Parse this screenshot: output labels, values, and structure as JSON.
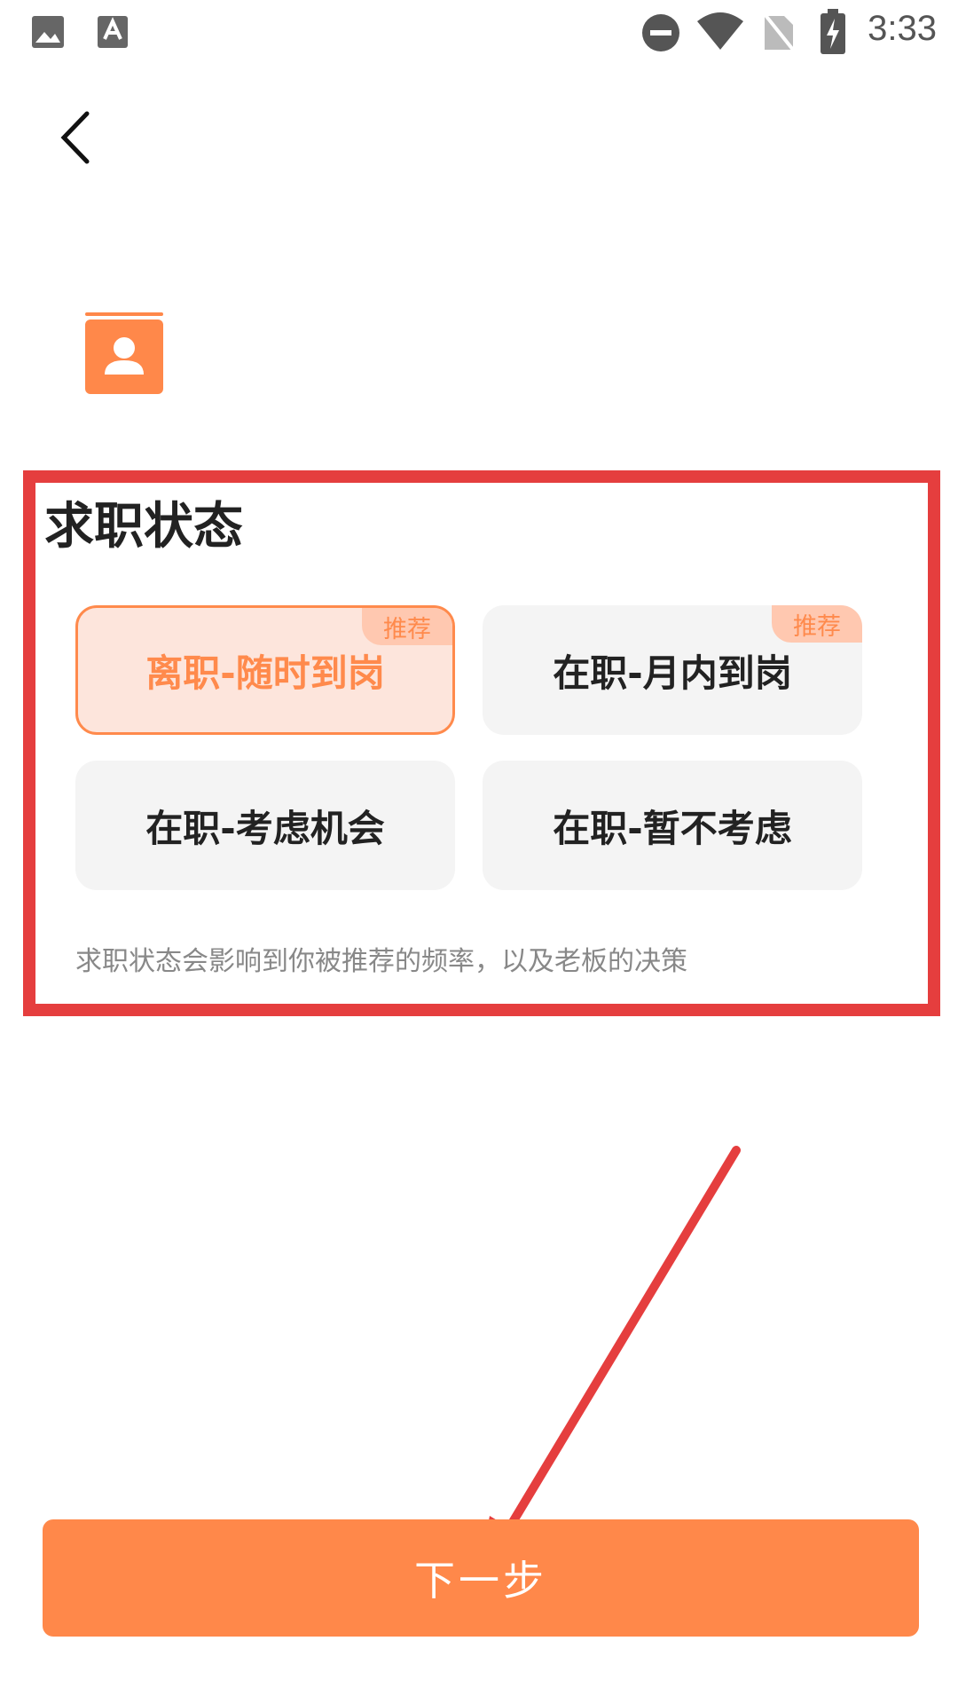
{
  "status_bar": {
    "time": "3:33",
    "left_icons": [
      "image-icon",
      "font-download-icon"
    ],
    "right_icons": [
      "do-not-disturb-icon",
      "wifi-icon",
      "no-sim-icon",
      "battery-charging-icon"
    ]
  },
  "header": {
    "back_icon": "chevron-left-icon"
  },
  "section": {
    "title": "求职状态",
    "hint": "求职状态会影响到你被推荐的频率，以及老板的决策"
  },
  "options": [
    {
      "label": "离职-随时到岗",
      "tag": "推荐",
      "selected": true
    },
    {
      "label": "在职-月内到岗",
      "tag": "推荐",
      "selected": false
    },
    {
      "label": "在职-考虑机会",
      "tag": "",
      "selected": false
    },
    {
      "label": "在职-暂不考虑",
      "tag": "",
      "selected": false
    }
  ],
  "footer": {
    "next_label": "下一步"
  },
  "colors": {
    "accent": "#ff884a",
    "selected_bg": "#fde5dc",
    "tag_bg": "#ffc8b0",
    "annotation_red": "#e53e3e"
  }
}
